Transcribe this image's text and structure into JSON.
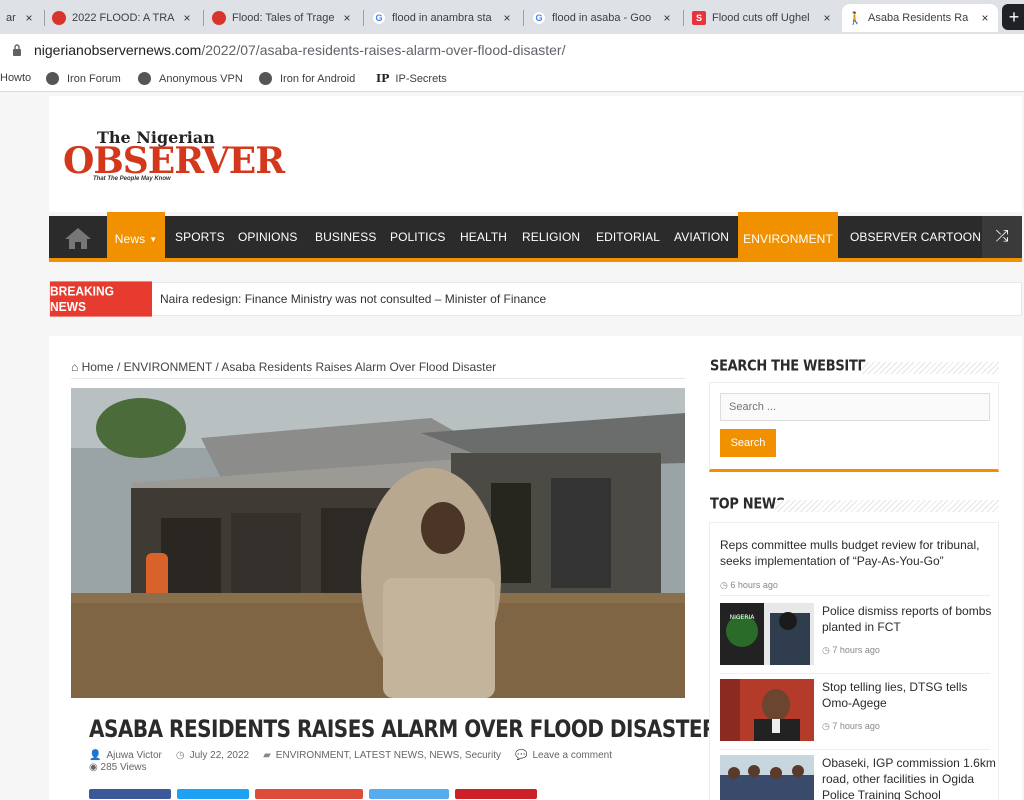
{
  "browser": {
    "tabs": [
      {
        "title": "ar",
        "active": false
      },
      {
        "title": "2022 FLOOD:  A TRA",
        "active": false
      },
      {
        "title": "Flood: Tales of Trage",
        "active": false
      },
      {
        "title": "flood in anambra sta",
        "active": false
      },
      {
        "title": "flood in asaba - Goo",
        "active": false
      },
      {
        "title": "Flood cuts off Ughel",
        "active": false
      },
      {
        "title": "Asaba Residents Ra",
        "active": true
      }
    ],
    "close_glyph": "×",
    "new_tab_glyph": "+",
    "url_host": "nigerianobservernews.com",
    "url_path": "/2022/07/asaba-residents-raises-alarm-over-flood-disaster/",
    "bookmarks": [
      "Howto",
      "Iron Forum",
      "Anonymous VPN",
      "Iron for Android",
      "IP-Secrets"
    ],
    "ip_badge": "IP"
  },
  "site": {
    "logo_the": "The Nigerian",
    "logo_big": "OBSERVER",
    "logo_tagline": "That The People May Know",
    "brand_color": "#f29100",
    "nav": {
      "items": [
        "News",
        "SPORTS",
        "OPINIONS",
        "BUSINESS",
        "POLITICS",
        "HEALTH",
        "RELIGION",
        "EDITORIAL",
        "AVIATION",
        "ENVIRONMENT",
        "OBSERVER CARTOON"
      ],
      "caret": "▼",
      "shuffle_glyph": "⤮"
    },
    "breaking": {
      "label": "BREAKING NEWS",
      "text": "Naira redesign: Finance Ministry was not consulted – Minister of Finance"
    }
  },
  "article": {
    "breadcrumb": "Home / ENVIRONMENT / Asaba Residents Raises Alarm Over Flood Disaster",
    "title": "Asaba Residents Raises Alarm Over Flood Disaster",
    "author": "Ajuwa Victor",
    "date": "July 22, 2022",
    "categories": "ENVIRONMENT, LATEST NEWS, NEWS, Security",
    "comment": "Leave a comment",
    "views": "285 Views"
  },
  "sidebar": {
    "search_title": "SEARCH THE WEBSITE",
    "search_placeholder": "Search ...",
    "search_button": "Search",
    "topnews_title": "TOP NEWS",
    "topnews": [
      {
        "title": "Reps committee mulls budget review for tribunal, seeks implementation of “Pay-As-You-Go”",
        "time": "6 hours ago"
      },
      {
        "title": "Police dismiss reports of bombs planted in FCT",
        "time": "7 hours ago"
      },
      {
        "title": "Stop telling lies, DTSG tells Omo-Agege",
        "time": "7 hours ago"
      },
      {
        "title": "Obaseki, IGP commission 1.6km road, other facilities in Ogida Police Training School",
        "time": ""
      }
    ]
  }
}
